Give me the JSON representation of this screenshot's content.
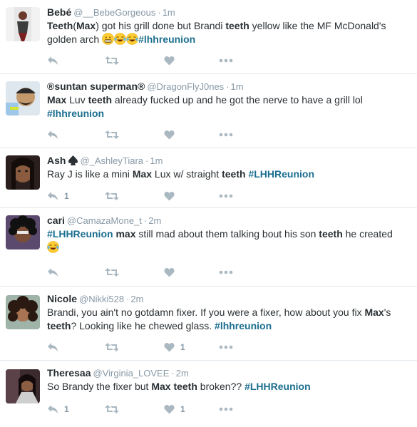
{
  "colors": {
    "name": "#292f33",
    "meta": "#8899a6",
    "hashtag": "#1b6e8f",
    "icon": "#aab8c2",
    "divider": "#e1e8ed"
  },
  "icons": {
    "reply": "reply-icon",
    "retweet": "retweet-icon",
    "like": "heart-icon",
    "more": "more-icon",
    "laugh_emoji": "face-with-tears-of-joy-emoji",
    "grimace_emoji": "grimacing-face-emoji",
    "spade": "spade-suit-icon"
  },
  "tweets": [
    {
      "name": "Bebé",
      "handle": "@__BebeGorgeous",
      "dot": "·",
      "time": "1m",
      "text": [
        {
          "k": "b",
          "t": "Teeth"
        },
        {
          "k": "n",
          "t": "("
        },
        {
          "k": "b",
          "t": "Max"
        },
        {
          "k": "n",
          "t": ") got his grill done but Brandi "
        },
        {
          "k": "b",
          "t": "teeth"
        },
        {
          "k": "n",
          "t": " yellow like the MF McDonald's golden arch  "
        },
        {
          "k": "emoji",
          "t": "grimace"
        },
        {
          "k": "emoji",
          "t": "laugh"
        },
        {
          "k": "emoji",
          "t": "laugh"
        },
        {
          "k": "tag",
          "t": "#lhhreunion"
        }
      ],
      "reply_count": "",
      "like_count": ""
    },
    {
      "name": "®suntan superman®",
      "handle": "@DragonFlyJ0nes",
      "dot": "·",
      "time": "1m",
      "text": [
        {
          "k": "b",
          "t": "Max"
        },
        {
          "k": "n",
          "t": " Luv "
        },
        {
          "k": "b",
          "t": "teeth"
        },
        {
          "k": "n",
          "t": " already fucked up and he got the nerve to have a grill lol "
        },
        {
          "k": "tag",
          "t": "#lhhreunion"
        }
      ],
      "reply_count": "",
      "like_count": ""
    },
    {
      "name": "Ash",
      "handle": "@_AshleyTiara",
      "dot": "·",
      "time": "1m",
      "text": [
        {
          "k": "n",
          "t": "Ray J is like a mini "
        },
        {
          "k": "b",
          "t": "Max"
        },
        {
          "k": "n",
          "t": " Lux w/ straight "
        },
        {
          "k": "b",
          "t": "teeth"
        },
        {
          "k": "n",
          "t": " "
        },
        {
          "k": "tag",
          "t": "#LHHReunion"
        }
      ],
      "reply_count": "1",
      "like_count": ""
    },
    {
      "name": "cari",
      "handle": "@CamazaMone_t",
      "dot": "·",
      "time": "2m",
      "text": [
        {
          "k": "tag",
          "t": "#LHHReunion"
        },
        {
          "k": "n",
          "t": " "
        },
        {
          "k": "b",
          "t": "max"
        },
        {
          "k": "n",
          "t": " still mad about them talking bout his son "
        },
        {
          "k": "b",
          "t": "teeth"
        },
        {
          "k": "n",
          "t": " he created "
        },
        {
          "k": "emoji",
          "t": "laugh"
        }
      ],
      "reply_count": "",
      "like_count": ""
    },
    {
      "name": "Nicole",
      "handle": "@Nikki528",
      "dot": "·",
      "time": "2m",
      "text": [
        {
          "k": "n",
          "t": "Brandi, you ain't no gotdamn fixer. If you were a fixer, how about you fix "
        },
        {
          "k": "b",
          "t": "Max"
        },
        {
          "k": "n",
          "t": "'s "
        },
        {
          "k": "b",
          "t": "teeth"
        },
        {
          "k": "n",
          "t": "? Looking like he chewed glass. "
        },
        {
          "k": "tag",
          "t": "#lhhreunion"
        }
      ],
      "reply_count": "",
      "like_count": "1"
    },
    {
      "name": "Theresaa",
      "handle": "@Virginia_LOVEE",
      "dot": "·",
      "time": "2m",
      "text": [
        {
          "k": "n",
          "t": "So Brandy the fixer but "
        },
        {
          "k": "b",
          "t": "Max"
        },
        {
          "k": "n",
          "t": " "
        },
        {
          "k": "b",
          "t": "teeth"
        },
        {
          "k": "n",
          "t": " broken?? "
        },
        {
          "k": "tag",
          "t": "#LHHReunion"
        }
      ],
      "reply_count": "1",
      "like_count": "1"
    }
  ]
}
